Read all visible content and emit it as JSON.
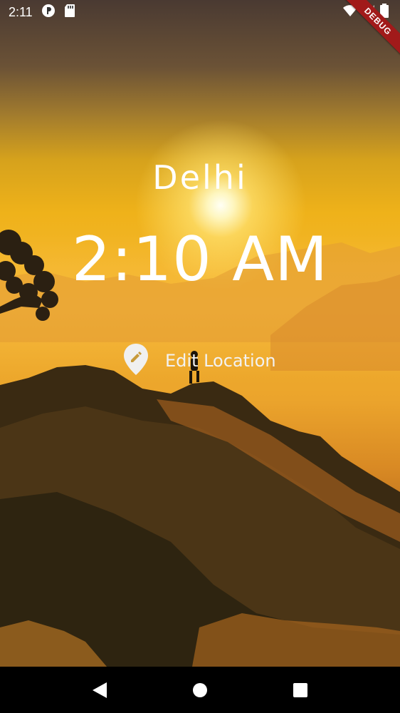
{
  "status_bar": {
    "time": "2:11",
    "debug_label": "DEBUG"
  },
  "main": {
    "location": "Delhi",
    "time": "2:10 AM",
    "edit_label": "Edit Location"
  },
  "nav": {
    "back": "back",
    "home": "home",
    "recents": "recents"
  },
  "colors": {
    "sky_top": "#4a3a32",
    "sky_gold": "#efb21a",
    "debug_ribbon": "#a11a1a",
    "text": "#ffffff"
  }
}
